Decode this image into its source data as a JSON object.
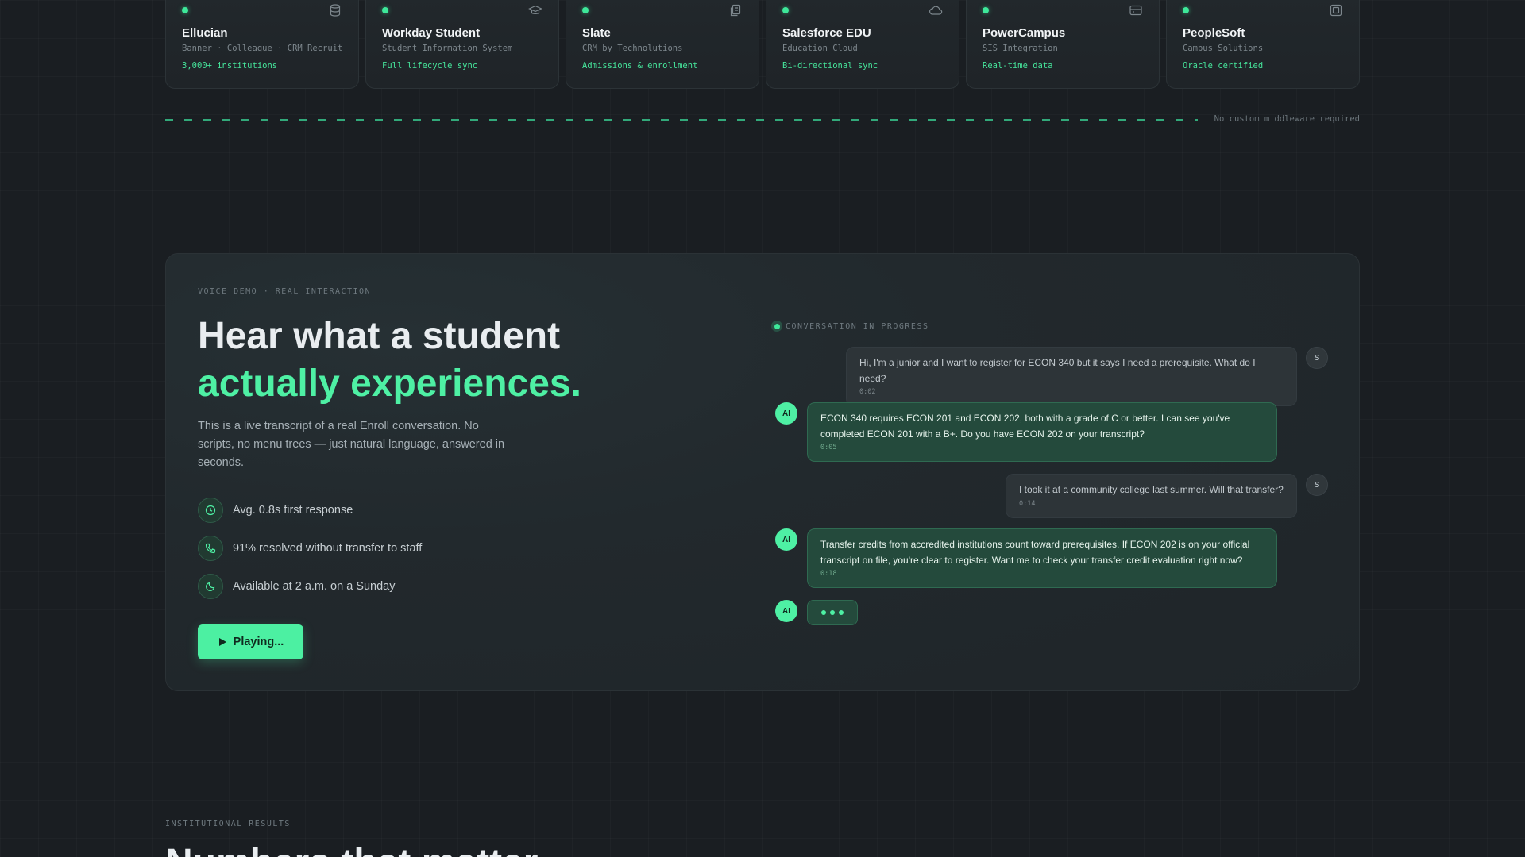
{
  "integrations": [
    {
      "name": "Ellucian",
      "sub": "Banner · Colleague · CRM Recruit",
      "tag": "3,000+ institutions",
      "icon": "database-icon"
    },
    {
      "name": "Workday Student",
      "sub": "Student Information System",
      "tag": "Full lifecycle sync",
      "icon": "graduation-cap-icon"
    },
    {
      "name": "Slate",
      "sub": "CRM by Technolutions",
      "tag": "Admissions & enrollment",
      "icon": "files-icon"
    },
    {
      "name": "Salesforce EDU",
      "sub": "Education Cloud",
      "tag": "Bi-directional sync",
      "icon": "cloud-icon"
    },
    {
      "name": "PowerCampus",
      "sub": "SIS Integration",
      "tag": "Real-time data",
      "icon": "server-icon"
    },
    {
      "name": "PeopleSoft",
      "sub": "Campus Solutions",
      "tag": "Oracle certified",
      "icon": "chip-icon"
    }
  ],
  "integration_note": "No custom middleware required",
  "demo": {
    "eyebrow": "VOICE DEMO · REAL INTERACTION",
    "title_line1": "Hear what a student",
    "title_line2": "actually experiences.",
    "lead": "This is a live transcript of a real Enroll conversation. No scripts, no menu trees — just natural language, answered in seconds.",
    "stats": [
      {
        "icon": "clock-icon",
        "text": "Avg. 0.8s first response"
      },
      {
        "icon": "phone-icon",
        "text": "91% resolved without transfer to staff"
      },
      {
        "icon": "moon-icon",
        "text": "Available at 2 a.m. on a Sunday"
      }
    ],
    "play_label": "Playing...",
    "conversation_label": "CONVERSATION IN PROGRESS",
    "messages": [
      {
        "role": "user",
        "avatar": "S",
        "text": "Hi, I'm a junior and I want to register for ECON 340 but it says I need a prerequisite. What do I need?",
        "time": "0:02"
      },
      {
        "role": "ai",
        "avatar": "AI",
        "text": "ECON 340 requires ECON 201 and ECON 202, both with a grade of C or better. I can see you've completed ECON 201 with a B+. Do you have ECON 202 on your transcript?",
        "time": "0:05"
      },
      {
        "role": "user",
        "avatar": "S",
        "text": "I took it at a community college last summer. Will that transfer?",
        "time": "0:14"
      },
      {
        "role": "ai",
        "avatar": "AI",
        "text": "Transfer credits from accredited institutions count toward prerequisites. If ECON 202 is on your official transcript on file, you're clear to register. Want me to check your transfer credit evaluation right now?",
        "time": "0:18"
      }
    ],
    "typing_avatar": "AI"
  },
  "results": {
    "eyebrow": "INSTITUTIONAL RESULTS",
    "title": "Numbers that matter"
  },
  "colors": {
    "accent": "#4ef0a4",
    "background": "#1a1e22"
  }
}
